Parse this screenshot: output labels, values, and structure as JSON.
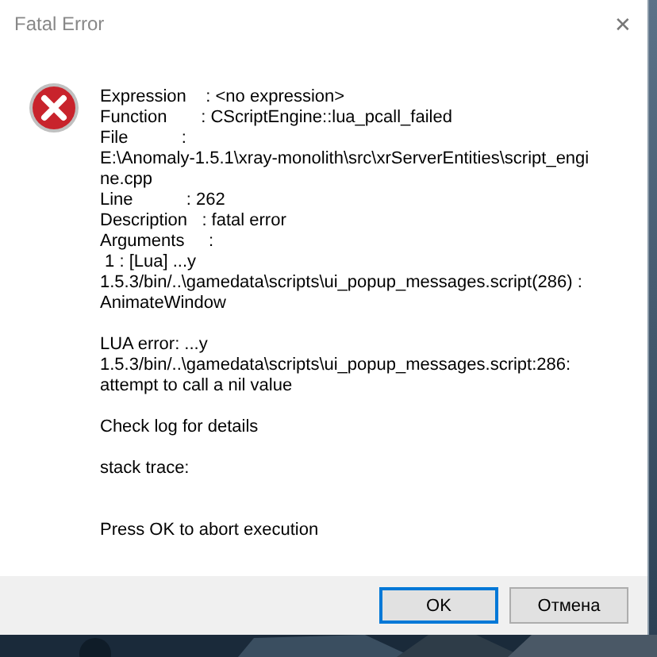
{
  "window": {
    "title": "Fatal Error",
    "close": "✕"
  },
  "message": {
    "paragraphs": [
      [
        "Expression    : <no expression>",
        "Function       : CScriptEngine::lua_pcall_failed",
        "File           :",
        "E:\\Anomaly-1.5.1\\xray-monolith\\src\\xrServerEntities\\script_engi",
        "ne.cpp",
        "Line           : 262",
        "Description   : fatal error",
        "Arguments     :",
        " 1 : [Lua] ...y",
        "1.5.3/bin/..\\gamedata\\scripts\\ui_popup_messages.script(286) :",
        "AnimateWindow"
      ],
      [
        "LUA error: ...y",
        "1.5.3/bin/..\\gamedata\\scripts\\ui_popup_messages.script:286:",
        "attempt to call a nil value"
      ],
      [
        "Check log for details"
      ],
      [
        "stack trace:"
      ]
    ],
    "prompt": "Press OK to abort execution"
  },
  "buttons": [
    {
      "label": "OK",
      "selected": true
    },
    {
      "label": "Отмена",
      "selected": false
    }
  ]
}
